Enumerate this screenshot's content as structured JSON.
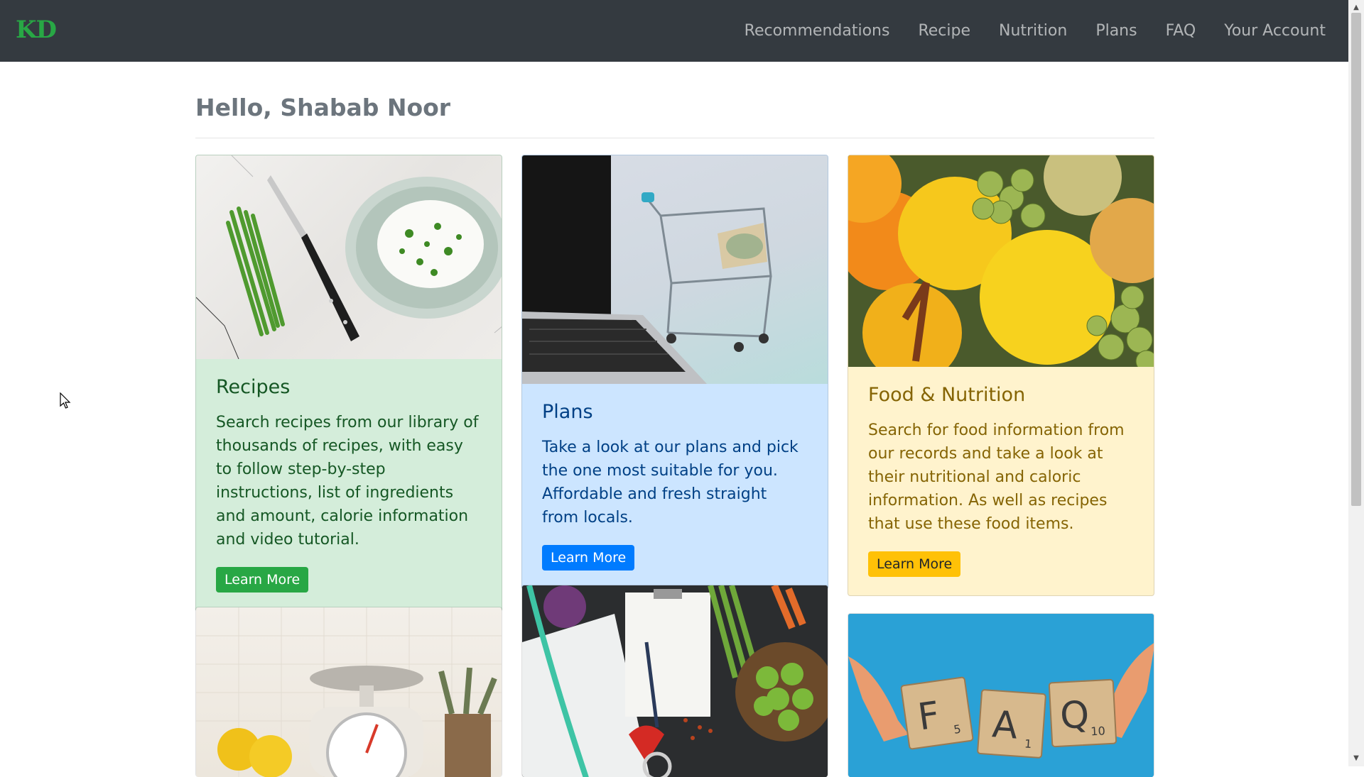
{
  "brand": "KD",
  "nav": [
    {
      "label": "Recommendations"
    },
    {
      "label": "Recipe"
    },
    {
      "label": "Nutrition"
    },
    {
      "label": "Plans"
    },
    {
      "label": "FAQ"
    },
    {
      "label": "Your Account"
    }
  ],
  "greeting": "Hello, Shabab Noor",
  "cards": {
    "recipes": {
      "title": "Recipes",
      "text": "Search recipes from our library of thousands of recipes, with easy to follow step-by-step instructions, list of ingredients and amount, calorie information and video tutorial.",
      "button": "Learn More",
      "image": "bowl-of-rice-with-scallions-and-knife"
    },
    "plans": {
      "title": "Plans",
      "text": "Take a look at our plans and pick the one most suitable for you. Affordable and fresh straight from locals.",
      "button": "Learn More",
      "image": "laptop-with-shopping-cart"
    },
    "nutrition": {
      "title": "Food & Nutrition",
      "text": "Search for food information from our records and take a look at their nutritional and caloric information. As well as recipes that use these food items.",
      "button": "Learn More",
      "image": "citrus-fruits-and-grapes"
    },
    "scale": {
      "image": "kitchen-scale-with-lemons"
    },
    "health": {
      "image": "vegetables-clipboard-stethoscope"
    },
    "faq": {
      "image": "scrabble-tiles-faq"
    }
  },
  "colors": {
    "navbar": "#343a40",
    "brand": "#28a745",
    "success": "#28a745",
    "primary": "#007bff",
    "warning": "#ffc107"
  }
}
